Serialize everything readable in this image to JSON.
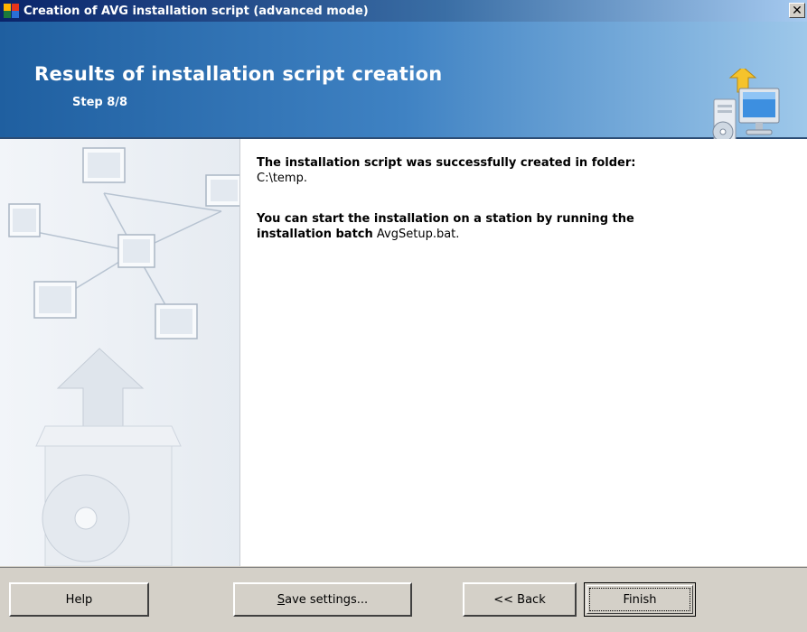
{
  "window": {
    "title": "Creation of AVG installation script (advanced mode)",
    "close_symbol": "✕"
  },
  "header": {
    "title": "Results of installation script creation",
    "step": "Step 8/8",
    "icon": "computer-install-icon"
  },
  "content": {
    "line1_bold": "The installation script was successfully created in folder:",
    "line1_value": "C:\\temp.",
    "line2_bold_a": "You can start the installation on a station by running the",
    "line2_bold_b": "installation batch",
    "line2_value": "AvgSetup.bat."
  },
  "buttons": {
    "help": "Help",
    "save_prefix": "S",
    "save_rest": "ave settings...",
    "back": "<< Back",
    "finish": "Finish"
  },
  "colors": {
    "banner_start": "#1f5fa0",
    "banner_end": "#9ec8ea",
    "titlebar": "#0a246a",
    "dialog_bg": "#d4d0c8"
  }
}
